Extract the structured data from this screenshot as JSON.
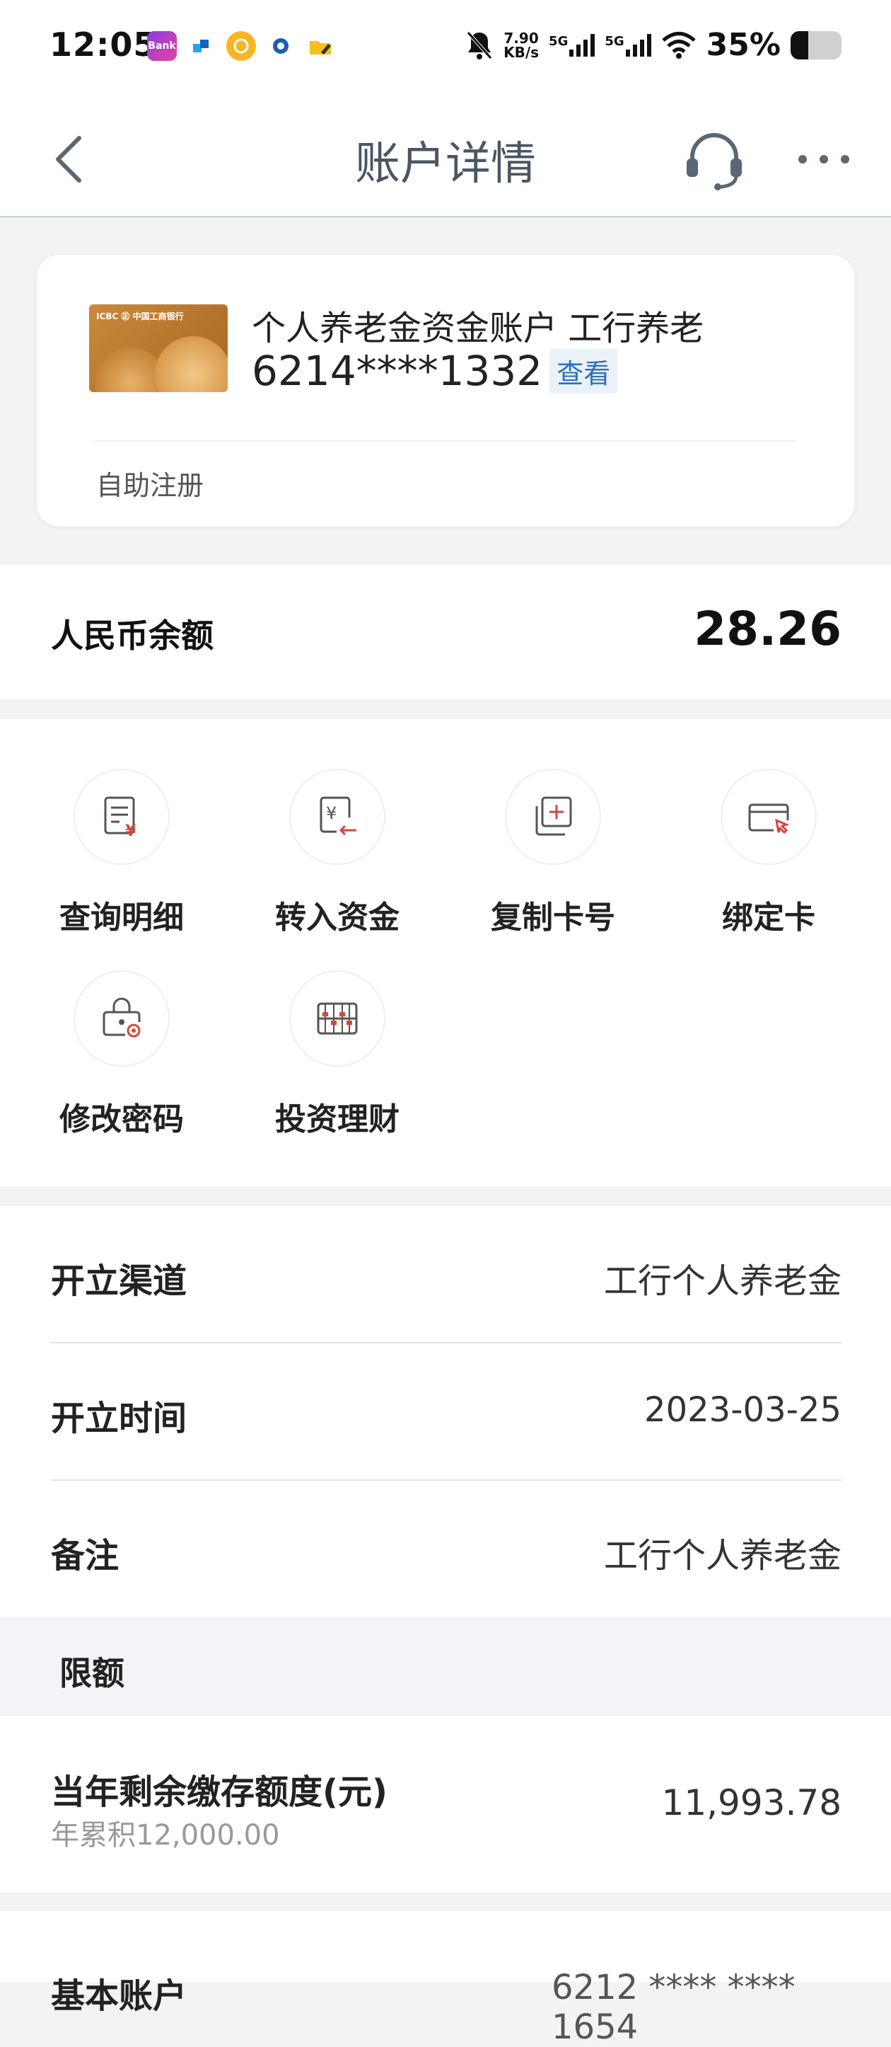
{
  "status_bar": {
    "time": "12:05",
    "net_speed_value": "7.90",
    "net_speed_unit": "KB/s",
    "signal1": "5G",
    "signal2": "5G",
    "battery_percent": "35%",
    "battery_level": 0.35,
    "app_badge_label": "Bank"
  },
  "nav": {
    "title": "账户详情"
  },
  "card": {
    "account_name": "个人养老金资金账户  工行养老",
    "card_number": "6214****1332",
    "view_label": "查看",
    "self_register": "自助注册",
    "card_logo_text": "ICBC ㊣ 中国工商银行"
  },
  "balance": {
    "label": "人民币余额",
    "value": "28.26"
  },
  "actions": [
    {
      "label": "查询明细",
      "icon": "statement-icon"
    },
    {
      "label": "转入资金",
      "icon": "transfer-in-icon"
    },
    {
      "label": "复制卡号",
      "icon": "copy-icon"
    },
    {
      "label": "绑定卡",
      "icon": "bind-card-icon"
    },
    {
      "label": "修改密码",
      "icon": "password-lock-icon"
    },
    {
      "label": "投资理财",
      "icon": "abacus-icon"
    }
  ],
  "info": [
    {
      "label": "开立渠道",
      "value": "工行个人养老金"
    },
    {
      "label": "开立时间",
      "value": "2023-03-25"
    },
    {
      "label": "备注",
      "value": "工行个人养老金"
    }
  ],
  "limits": {
    "title": "限额",
    "remaining_label": "当年剩余缴存额度(元)",
    "accumulated": "年累积12,000.00",
    "remaining_value": "11,993.78"
  },
  "bottom_partial": {
    "label": "基本账户",
    "value": "6212 **** **** 1654"
  },
  "colors": {
    "accent_blue": "#2e6fb8",
    "icon_red": "#d9453b",
    "nav_title": "#4a5663"
  }
}
